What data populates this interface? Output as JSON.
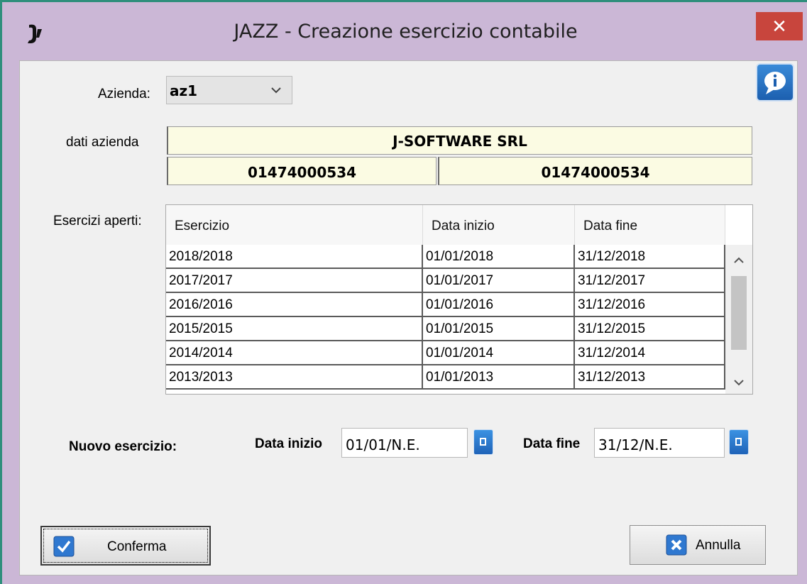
{
  "window": {
    "title": "JAZZ - Creazione esercizio contabile",
    "close_glyph": "✕",
    "accent": "#2e8f7c",
    "titlebar_color": "#cbb7d6",
    "close_color": "#c8453d"
  },
  "icons": {
    "app": "jazz-logo-icon",
    "info": "info-speech-bubble-icon",
    "calendar": "calendar-icon",
    "confirm": "checkmark-icon",
    "cancel": "x-icon"
  },
  "azienda": {
    "label": "Azienda:",
    "value": "az1"
  },
  "dati_azienda": {
    "label": "dati azienda",
    "name": "J-SOFTWARE SRL",
    "code_left": "01474000534",
    "code_right": "01474000534",
    "field_bg": "#fbfbe3"
  },
  "esercizi": {
    "label": "Esercizi aperti:",
    "columns": [
      "Esercizio",
      "Data inizio",
      "Data fine"
    ],
    "rows": [
      [
        "2018/2018",
        "01/01/2018",
        "31/12/2018"
      ],
      [
        "2017/2017",
        "01/01/2017",
        "31/12/2017"
      ],
      [
        "2016/2016",
        "01/01/2016",
        "31/12/2016"
      ],
      [
        "2015/2015",
        "01/01/2015",
        "31/12/2015"
      ],
      [
        "2014/2014",
        "01/01/2014",
        "31/12/2014"
      ],
      [
        "2013/2013",
        "01/01/2013",
        "31/12/2013"
      ]
    ]
  },
  "nuovo": {
    "label": "Nuovo esercizio:",
    "data_inizio_label": "Data inizio",
    "data_inizio_value": "01/01/N.E.",
    "data_fine_label": "Data fine",
    "data_fine_value": "31/12/N.E."
  },
  "buttons": {
    "confirm": "Conferma",
    "cancel": "Annulla"
  }
}
